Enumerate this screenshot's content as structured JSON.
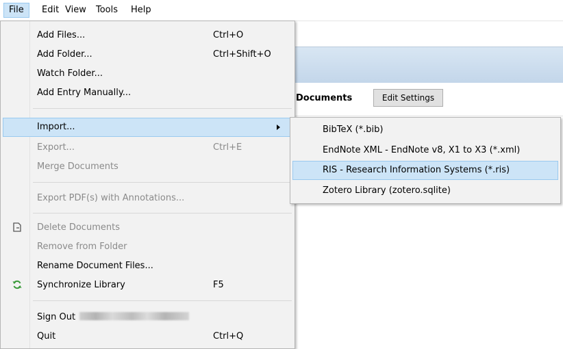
{
  "menubar": {
    "items": [
      "File",
      "Edit",
      "View",
      "Tools",
      "Help"
    ]
  },
  "background": {
    "section_title": "Documents",
    "edit_settings_label": "Edit Settings"
  },
  "file_menu": {
    "add_files": {
      "label": "Add Files...",
      "shortcut": "Ctrl+O"
    },
    "add_folder": {
      "label": "Add Folder...",
      "shortcut": "Ctrl+Shift+O"
    },
    "watch_folder": {
      "label": "Watch Folder..."
    },
    "add_entry": {
      "label": "Add Entry Manually..."
    },
    "import": {
      "label": "Import..."
    },
    "export": {
      "label": "Export...",
      "shortcut": "Ctrl+E"
    },
    "merge": {
      "label": "Merge Documents"
    },
    "export_pdf": {
      "label": "Export PDF(s) with Annotations..."
    },
    "delete": {
      "label": "Delete Documents",
      "icon": "delete-document-icon"
    },
    "remove_folder": {
      "label": "Remove from Folder"
    },
    "rename": {
      "label": "Rename Document Files..."
    },
    "sync": {
      "label": "Synchronize Library",
      "shortcut": "F5",
      "icon": "sync-icon"
    },
    "sign_out": {
      "label": "Sign Out"
    },
    "quit": {
      "label": "Quit",
      "shortcut": "Ctrl+Q"
    }
  },
  "import_submenu": {
    "items": [
      "BibTeX (*.bib)",
      "EndNote XML - EndNote v8, X1 to X3 (*.xml)",
      "RIS - Research Information Systems (*.ris)",
      "Zotero Library (zotero.sqlite)"
    ]
  },
  "colors": {
    "highlight": "#cce4f7",
    "highlight_border": "#99c9ef",
    "sync_green": "#3a9a3a"
  }
}
